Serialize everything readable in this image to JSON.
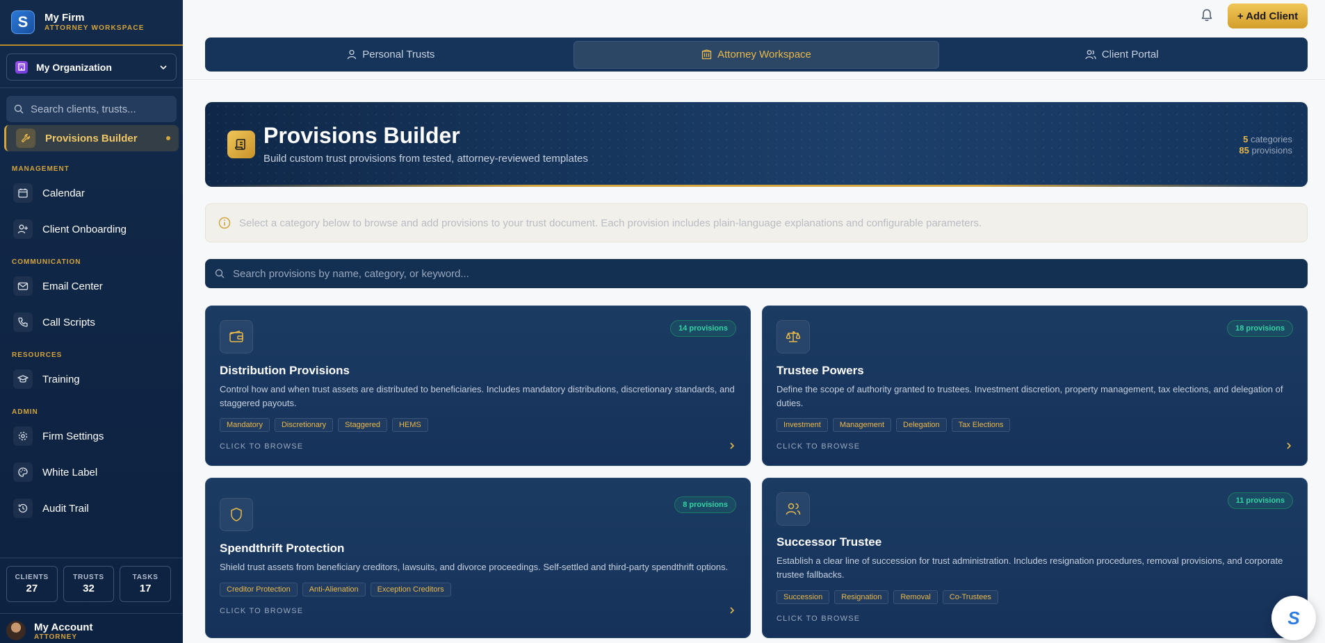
{
  "sidebar": {
    "brand_name": "My Firm",
    "brand_sub": "ATTORNEY WORKSPACE",
    "brand_letter": "S",
    "org_name": "My Organization",
    "search_placeholder": "Search clients, trusts...",
    "active_item": "Provisions Builder",
    "sections": {
      "management": "MANAGEMENT",
      "communication": "COMMUNICATION",
      "resources": "RESOURCES",
      "admin": "ADMIN"
    },
    "items": {
      "calendar": "Calendar",
      "onboarding": "Client Onboarding",
      "email": "Email Center",
      "scripts": "Call Scripts",
      "training": "Training",
      "firm_settings": "Firm Settings",
      "white_label": "White Label",
      "audit": "Audit Trail"
    },
    "stats": [
      {
        "label": "CLIENTS",
        "value": "27"
      },
      {
        "label": "TRUSTS",
        "value": "32"
      },
      {
        "label": "TASKS",
        "value": "17"
      }
    ],
    "account_name": "My Account",
    "account_role": "ATTORNEY"
  },
  "header": {
    "add_client": "+ Add Client"
  },
  "tabs": [
    {
      "label": "Personal Trusts",
      "icon": "user-icon"
    },
    {
      "label": "Attorney Workspace",
      "icon": "building-icon",
      "active": true
    },
    {
      "label": "Client Portal",
      "icon": "users-icon"
    }
  ],
  "hero": {
    "title": "Provisions Builder",
    "subtitle": "Build custom trust provisions from tested, attorney-reviewed templates",
    "categories_count": "5",
    "categories_label": "categories",
    "provisions_count": "85",
    "provisions_label": "provisions"
  },
  "info_text": "Select a category below to browse and add provisions to your trust document. Each provision includes plain-language explanations and configurable parameters.",
  "provision_search_placeholder": "Search provisions by name, category, or keyword...",
  "cards": [
    {
      "title": "Distribution Provisions",
      "badge": "14 provisions",
      "desc": "Control how and when trust assets are distributed to beneficiaries. Includes mandatory distributions, discretionary standards, and staggered payouts.",
      "tags": [
        "Mandatory",
        "Discretionary",
        "Staggered",
        "HEMS"
      ],
      "browse": "CLICK TO BROWSE",
      "icon": "wallet-icon"
    },
    {
      "title": "Trustee Powers",
      "badge": "18 provisions",
      "desc": "Define the scope of authority granted to trustees. Investment discretion, property management, tax elections, and delegation of duties.",
      "tags": [
        "Investment",
        "Management",
        "Delegation",
        "Tax Elections"
      ],
      "browse": "CLICK TO BROWSE",
      "icon": "scale-icon"
    },
    {
      "title": "Spendthrift Protection",
      "badge": "8 provisions",
      "desc": "Shield trust assets from beneficiary creditors, lawsuits, and divorce proceedings. Self-settled and third-party spendthrift options.",
      "tags": [
        "Creditor Protection",
        "Anti-Alienation",
        "Exception Creditors"
      ],
      "browse": "CLICK TO BROWSE",
      "icon": "shield-icon"
    },
    {
      "title": "Successor Trustee",
      "badge": "11 provisions",
      "desc": "Establish a clear line of succession for trust administration. Includes resignation procedures, removal provisions, and corporate trustee fallbacks.",
      "tags": [
        "Succession",
        "Resignation",
        "Removal",
        "Co-Trustees"
      ],
      "browse": "CLICK TO BROWSE",
      "icon": "users-icon"
    }
  ],
  "fab_letter": "S",
  "colors": {
    "accent": "#d4a43d",
    "navy": "#132f52",
    "success": "#34d3a4"
  }
}
